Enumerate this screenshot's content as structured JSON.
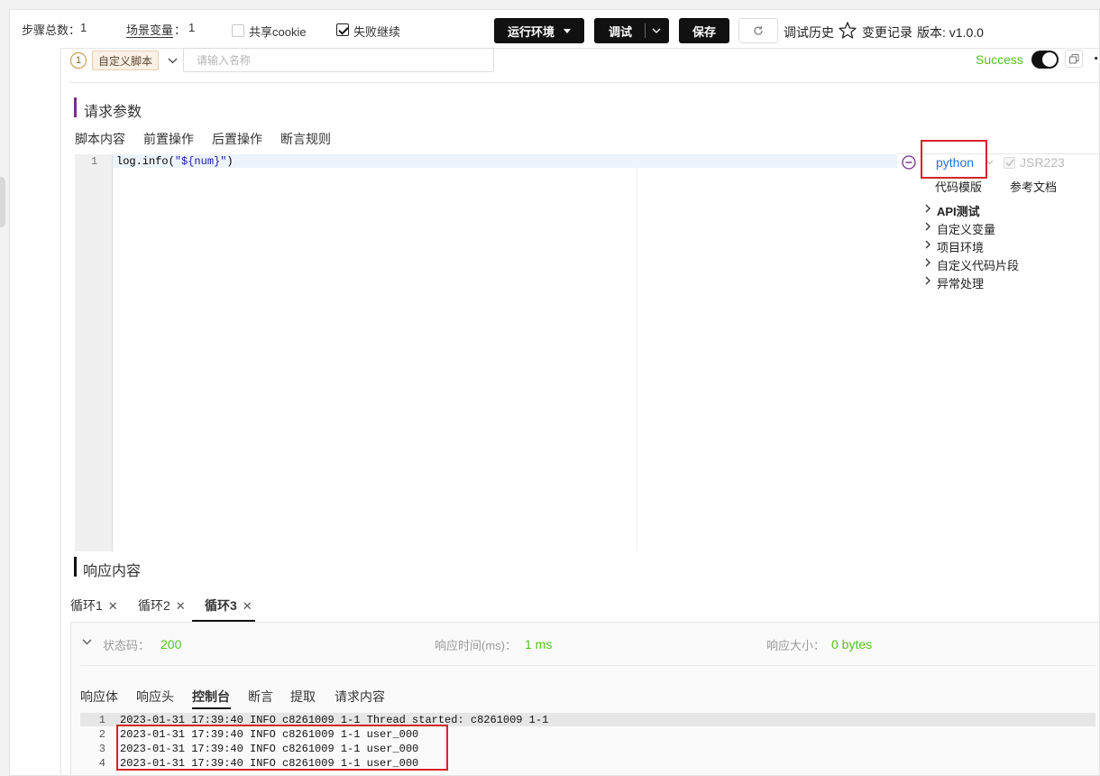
{
  "topbar": {
    "steps_label": "步骤总数：",
    "steps_value": "1",
    "vars_label": "场景变量",
    "vars_sep": "：",
    "vars_value": "1",
    "share_cookie": "共享cookie",
    "fail_continue": "失败继续",
    "run_env": "运行环境",
    "debug": "调试",
    "save": "保存",
    "debug_history": "调试历史",
    "change_log": "变更记录",
    "version": "版本: v1.0.0"
  },
  "step": {
    "index": "1",
    "type_tag": "自定义脚本",
    "name_placeholder": "请输入名称",
    "status": "Success"
  },
  "request": {
    "title": "请求参数",
    "tabs": [
      "脚本内容",
      "前置操作",
      "后置操作",
      "断言规则"
    ],
    "code_lines": [
      {
        "num": "1",
        "prefix": "log.info(",
        "string": "\"${num}\"",
        "suffix": ")"
      }
    ],
    "language": "python",
    "jsr": "JSR223",
    "code_template": "代码模版",
    "ref_docs": "参考文档",
    "tree": [
      "API测试",
      "自定义变量",
      "项目环境",
      "自定义代码片段",
      "异常处理"
    ]
  },
  "response": {
    "title": "响应内容",
    "loops": [
      "循环1",
      "循环2",
      "循环3"
    ],
    "status_label": "状态码：",
    "status_value": "200",
    "time_label": "响应时间(ms)：",
    "time_value": "1 ms",
    "size_label": "响应大小：",
    "size_value": "0 bytes",
    "tabs": [
      "响应体",
      "响应头",
      "控制台",
      "断言",
      "提取",
      "请求内容"
    ],
    "console": [
      {
        "num": "1",
        "text": "2023-01-31 17:39:40 INFO c8261009 1-1 Thread started: c8261009 1-1"
      },
      {
        "num": "2",
        "text": "2023-01-31 17:39:40 INFO c8261009 1-1 user_000"
      },
      {
        "num": "3",
        "text": "2023-01-31 17:39:40 INFO c8261009 1-1 user_000"
      },
      {
        "num": "4",
        "text": "2023-01-31 17:39:40 INFO c8261009 1-1 user_000"
      }
    ]
  },
  "colors": {
    "accent_purple": "#7b2d8e",
    "success_green": "#52c41a",
    "link_blue": "#1e73e8",
    "highlight_red": "#d4242c"
  }
}
